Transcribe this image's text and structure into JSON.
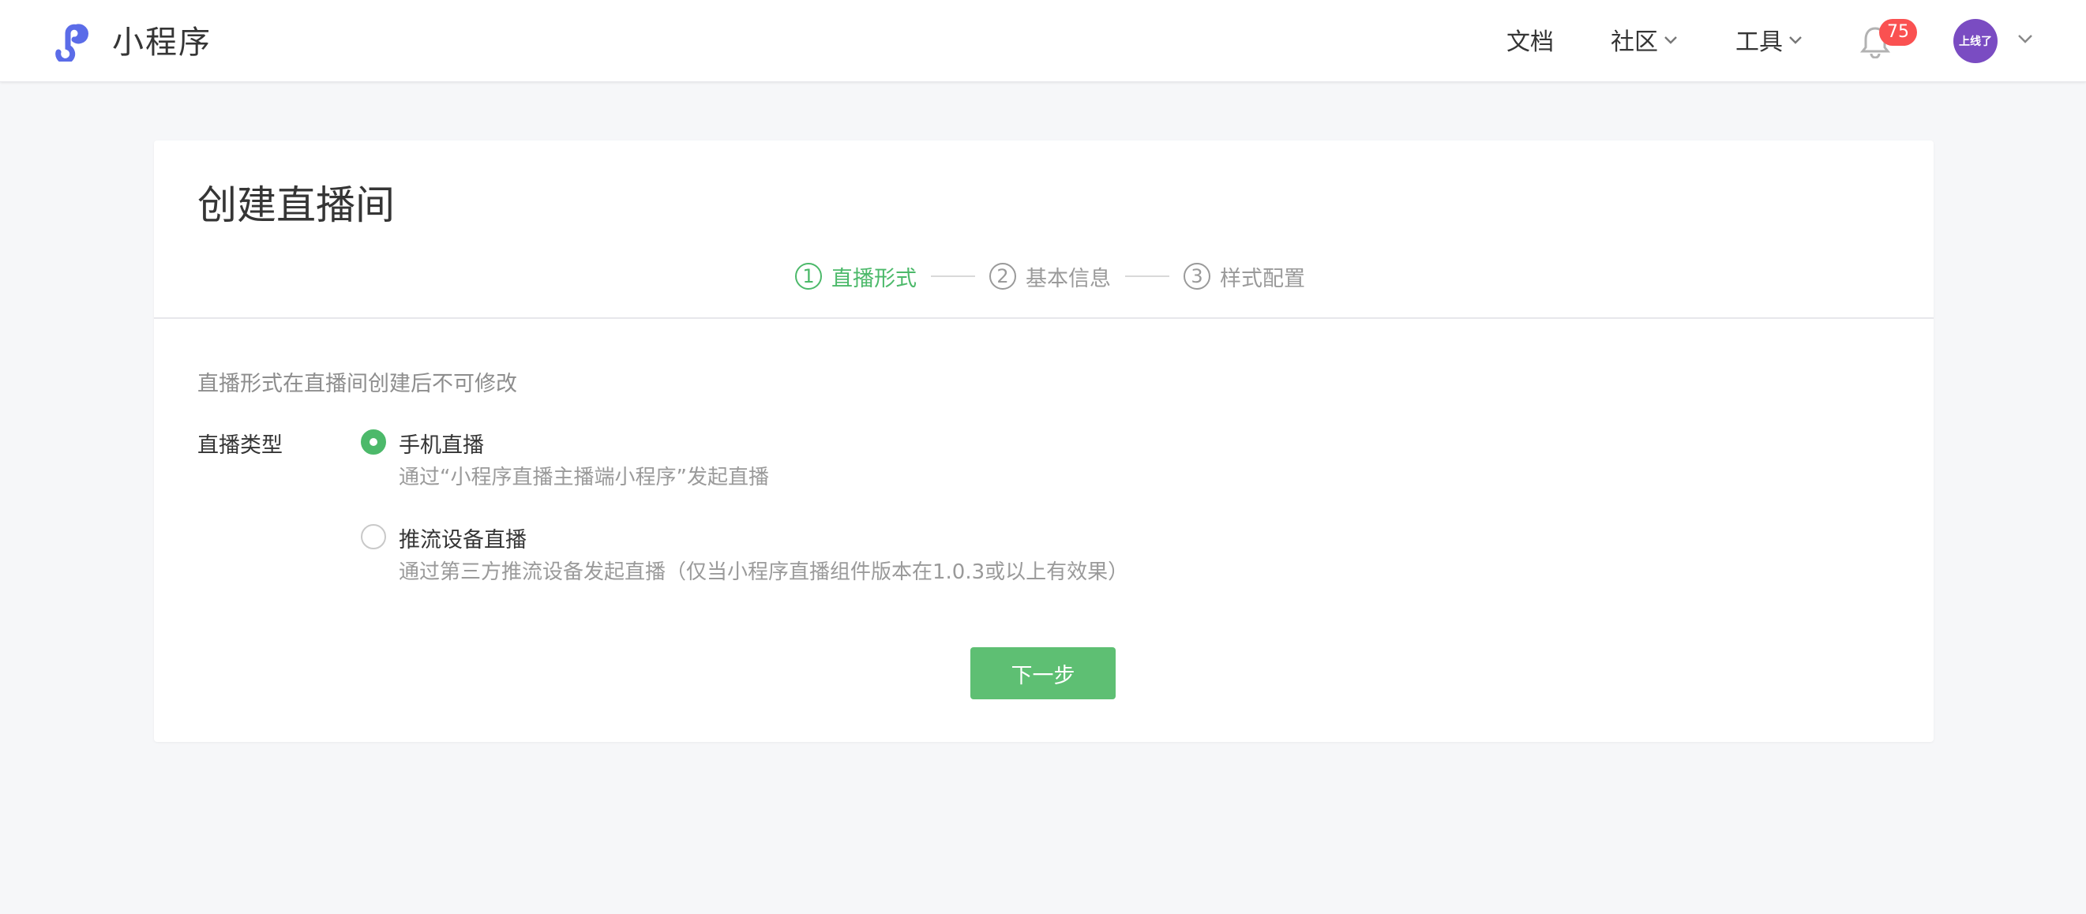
{
  "app": {
    "logo_text": "小程序"
  },
  "nav": {
    "docs": "文档",
    "community": "社区",
    "tools": "工具",
    "notification_count": "75",
    "avatar_text": "上线了"
  },
  "page": {
    "title": "创建直播间"
  },
  "steps": [
    {
      "num": "1",
      "label": "直播形式",
      "active": true
    },
    {
      "num": "2",
      "label": "基本信息",
      "active": false
    },
    {
      "num": "3",
      "label": "样式配置",
      "active": false
    }
  ],
  "form": {
    "notice": "直播形式在直播间创建后不可修改",
    "type_label": "直播类型",
    "options": [
      {
        "title": "手机直播",
        "desc": "通过“小程序直播主播端小程序”发起直播",
        "checked": true
      },
      {
        "title": "推流设备直播",
        "desc": "通过第三方推流设备发起直播（仅当小程序直播组件版本在1.0.3或以上有效果）",
        "checked": false
      }
    ],
    "next_label": "下一步"
  },
  "colors": {
    "accent": "#4cb96a",
    "button": "#5ebf73",
    "badge": "#fa5151",
    "avatar": "#7a4cc2",
    "logo": "#5b6ce8"
  }
}
